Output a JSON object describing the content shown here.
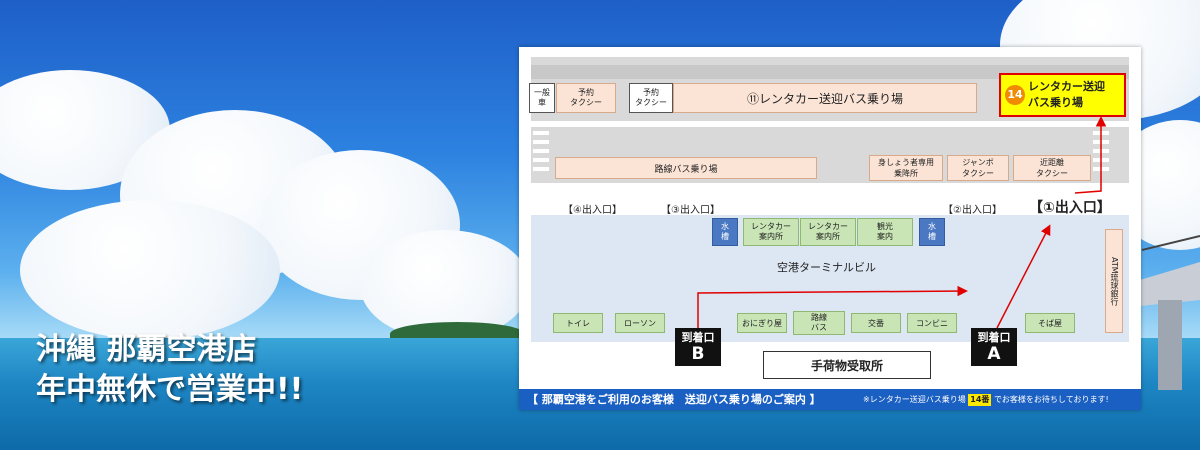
{
  "headline": {
    "line1": "沖縄 那覇空港店",
    "line2": "年中無休で営業中!!"
  },
  "map": {
    "top_row": {
      "general_car": "一般\n車",
      "reserved_taxi_1": "予約\nタクシー",
      "reserved_taxi_2": "予約\nタクシー",
      "shuttle_11": "⑪レンタカー送迎バス乗り場",
      "shuttle_14_number": "14",
      "shuttle_14_label": "レンタカー送迎\nバス乗り場"
    },
    "second_row": {
      "route_bus": "路線バス乗り場",
      "disabled": "身しょう者専用\n乗降所",
      "jumbo_taxi": "ジャンボ\nタクシー",
      "short_taxi": "近距離\nタクシー"
    },
    "entrances": {
      "e4": "【④出入口】",
      "e3": "【③出入口】",
      "e2": "【②出入口】",
      "e1": "【①出入口】"
    },
    "terminal": {
      "water_1": "水\n槽",
      "rental_info_1": "レンタカー\n案内所",
      "rental_info_2": "レンタカー\n案内所",
      "tourism_info": "観光\n案内",
      "water_2": "水\n槽",
      "name": "空港ターミナルビル",
      "atm": "ATM琉球銀行",
      "toilet": "トイレ",
      "lawson": "ローソン",
      "onigiri": "おにぎり屋",
      "route_bus": "路線\nバス",
      "police": "交番",
      "convenience": "コンビニ",
      "soba": "そば屋"
    },
    "gates": {
      "b_label": "到着口",
      "b_letter": "B",
      "a_label": "到着口",
      "a_letter": "A"
    },
    "baggage": "手荷物受取所",
    "footer": {
      "title": "【 那覇空港をご利用のお客様　送迎バス乗り場のご案内 】",
      "note_pre": "※レンタカー送迎バス乗り場",
      "note_num": "14番",
      "note_post": "でお客様をお待ちしております!"
    },
    "colors": {
      "route_arrow": "#e00000",
      "footer_bg": "#1a5fc2",
      "highlight": "#ffff00"
    }
  }
}
